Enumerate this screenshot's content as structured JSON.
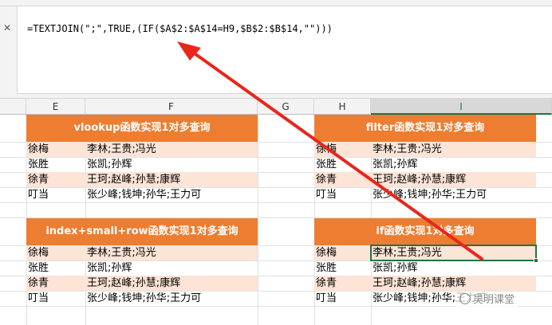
{
  "formula_bar": {
    "cancel_icon": "close-icon",
    "formula": "=TEXTJOIN(\";\",TRUE,(IF($A$2:$A$14=H9,$B$2:$B$14,\"\")))"
  },
  "columns": [
    "E",
    "F",
    "G",
    "H",
    "I"
  ],
  "selected_column": "I",
  "tables": [
    {
      "title": "vlookup函数实现1对多查询",
      "rows": [
        {
          "name": "徐梅",
          "values": "李林;王贵;冯光"
        },
        {
          "name": "张胜",
          "values": "张凯;孙辉"
        },
        {
          "name": "徐青",
          "values": "王珂;赵峰;孙慧;康辉"
        },
        {
          "name": "叮当",
          "values": "张少峰;钱坤;孙华;王力可"
        }
      ]
    },
    {
      "title": "filter函数实现1对多查询",
      "rows": [
        {
          "name": "徐梅",
          "values": "李林;王贵;冯光"
        },
        {
          "name": "张胜",
          "values": "张凯;孙辉"
        },
        {
          "name": "徐青",
          "values": "王珂;赵峰;孙慧;康辉"
        },
        {
          "name": "叮当",
          "values": "张少峰;钱坤;孙华;王力可"
        }
      ]
    },
    {
      "title": "index+small+row函数实现1对多查询",
      "rows": [
        {
          "name": "徐梅",
          "values": "李林;王贵;冯光"
        },
        {
          "name": "张胜",
          "values": "张凯;孙辉"
        },
        {
          "name": "徐青",
          "values": "王珂;赵峰;孙慧;康辉"
        },
        {
          "name": "叮当",
          "values": "张少峰;钱坤;孙华;王力可"
        }
      ]
    },
    {
      "title": "if函数实现1对多查询",
      "rows": [
        {
          "name": "徐梅",
          "values": "李林;王贵;冯光"
        },
        {
          "name": "张胜",
          "values": "张凯;孙辉"
        },
        {
          "name": "徐青",
          "values": "王珂;赵峰;孙慧;康辉"
        },
        {
          "name": "叮当",
          "values": "张少峰;钱坤;孙华;王力可"
        }
      ]
    }
  ],
  "watermark": "吴明课堂",
  "colors": {
    "header_orange": "#ed7d31",
    "alt_row": "#fce4d6",
    "selection_green": "#217346",
    "arrow_red": "#e8261c"
  }
}
